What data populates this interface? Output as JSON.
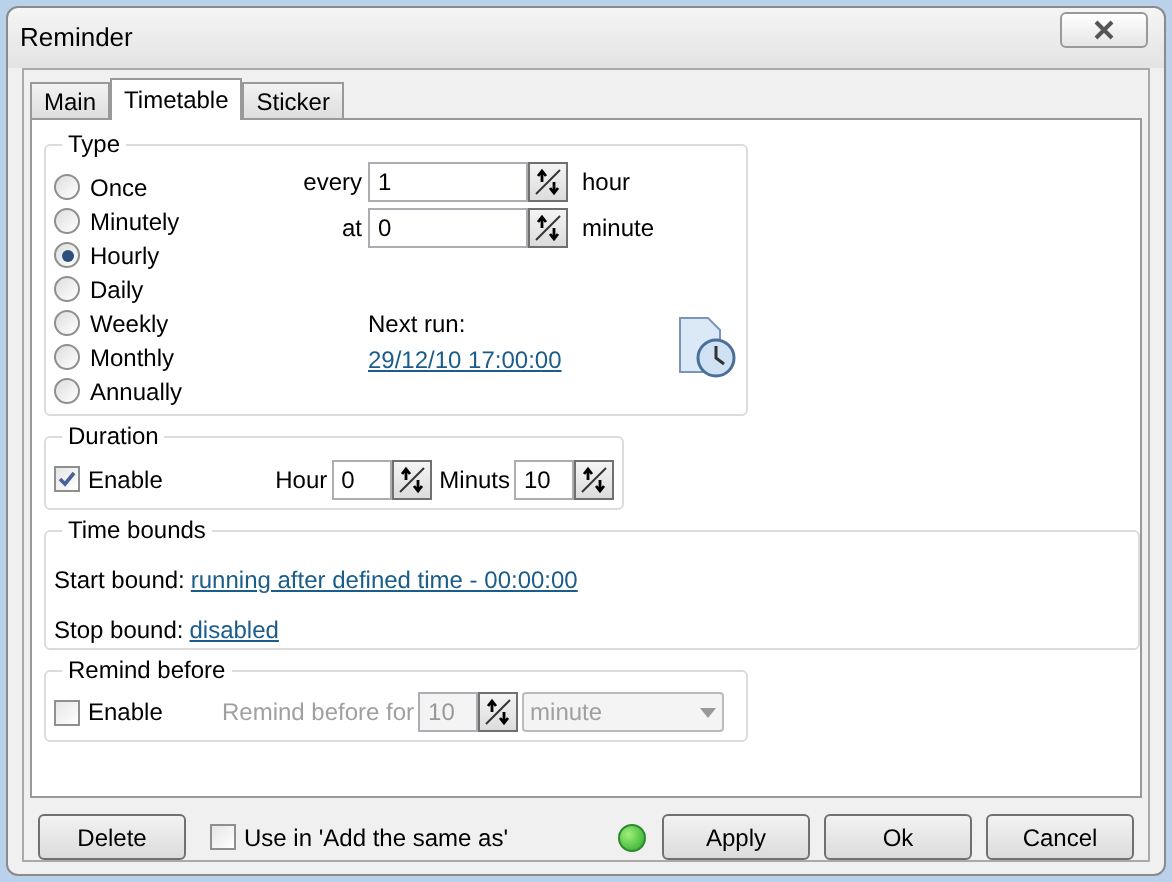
{
  "window": {
    "title": "Reminder"
  },
  "tabs": [
    {
      "label": "Main",
      "selected": false
    },
    {
      "label": "Timetable",
      "selected": true
    },
    {
      "label": "Sticker",
      "selected": false
    }
  ],
  "type_group": {
    "title": "Type",
    "options": [
      {
        "label": "Once",
        "selected": false
      },
      {
        "label": "Minutely",
        "selected": false
      },
      {
        "label": "Hourly",
        "selected": true
      },
      {
        "label": "Daily",
        "selected": false
      },
      {
        "label": "Weekly",
        "selected": false
      },
      {
        "label": "Monthly",
        "selected": false
      },
      {
        "label": "Annually",
        "selected": false
      }
    ],
    "every": {
      "label": "every",
      "value": "1",
      "unit": "hour"
    },
    "at": {
      "label": "at",
      "value": "0",
      "unit": "minute"
    },
    "next_run": {
      "label": "Next run:",
      "value": "29/12/10 17:00:00"
    }
  },
  "duration": {
    "title": "Duration",
    "enable": {
      "label": "Enable",
      "checked": true
    },
    "hour": {
      "label": "Hour",
      "value": "0"
    },
    "minutes": {
      "label": "Minuts",
      "value": "10"
    }
  },
  "time_bounds": {
    "title": "Time bounds",
    "rows": [
      {
        "label": "Start bound:",
        "link": "running after defined time - 00:00:00"
      },
      {
        "label": "Stop bound:",
        "link": "disabled"
      }
    ]
  },
  "remind_before": {
    "title": "Remind before",
    "enable": {
      "label": "Enable",
      "checked": false
    },
    "for": {
      "label": "Remind before for",
      "value": "10",
      "disabled": true
    },
    "unit": {
      "value": "minute",
      "disabled": true
    }
  },
  "footer": {
    "delete": "Delete",
    "use_in": {
      "label": "Use in 'Add the same as'",
      "checked": false
    },
    "buttons": [
      "Apply",
      "Ok",
      "Cancel"
    ]
  }
}
